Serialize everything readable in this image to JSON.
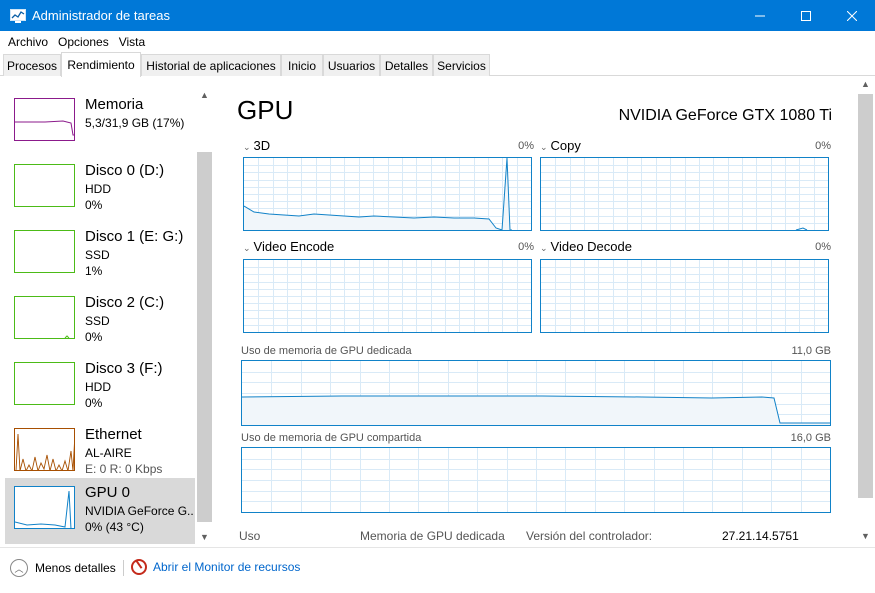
{
  "window": {
    "title": "Administrador de tareas",
    "minimize_icon": "minimize-icon",
    "maximize_icon": "maximize-icon",
    "close_icon": "close-icon"
  },
  "menu": [
    "Archivo",
    "Opciones",
    "Vista"
  ],
  "tabs": [
    "Procesos",
    "Rendimiento",
    "Historial de aplicaciones",
    "Inicio",
    "Usuarios",
    "Detalles",
    "Servicios"
  ],
  "active_tab": "Rendimiento",
  "devices": [
    {
      "name": "Memoria",
      "line1": "5,3/31,9 GB (17%)",
      "line2": "",
      "color": "#8b1a8b",
      "usage_fraction": 0.17
    },
    {
      "name": "Disco 0 (D:)",
      "line1": "HDD",
      "line2": "0%",
      "color": "#4cbb17",
      "usage_fraction": 0.0
    },
    {
      "name": "Disco 1 (E: G:)",
      "line1": "SSD",
      "line2": "1%",
      "color": "#4cbb17",
      "usage_fraction": 0.01
    },
    {
      "name": "Disco 2 (C:)",
      "line1": "SSD",
      "line2": "0%",
      "color": "#4cbb17",
      "usage_fraction": 0.0
    },
    {
      "name": "Disco 3 (F:)",
      "line1": "HDD",
      "line2": "0%",
      "color": "#4cbb17",
      "usage_fraction": 0.0
    },
    {
      "name": "Ethernet",
      "line1": "AL-AIRE",
      "line2": "E: 0 R: 0 Kbps",
      "color": "#a74f01",
      "usage_fraction": 0.0
    },
    {
      "name": "GPU 0",
      "line1": "NVIDIA GeForce G...",
      "line2": "0% (43 °C)",
      "color": "#1182c8",
      "usage_fraction": 0.0
    }
  ],
  "selected_device": "GPU 0",
  "gpu": {
    "title": "GPU",
    "model": "NVIDIA GeForce GTX 1080 Ti",
    "engines": [
      {
        "label": "3D",
        "percent": "0%"
      },
      {
        "label": "Copy",
        "percent": "0%"
      },
      {
        "label": "Video Encode",
        "percent": "0%"
      },
      {
        "label": "Video Decode",
        "percent": "0%"
      }
    ],
    "dedicated_label": "Uso de memoria de GPU dedicada",
    "dedicated_max": "11,0 GB",
    "shared_label": "Uso de memoria de GPU compartida",
    "shared_max": "16,0 GB",
    "stats": {
      "usage_label": "Uso",
      "dedicated_mem_label": "Memoria de GPU dedicada",
      "driver_label": "Versión del controlador:",
      "driver_value": "27.21.14.5751"
    }
  },
  "footer": {
    "fewer_details": "Menos detalles",
    "open_monitor": "Abrir el Monitor de recursos"
  },
  "colors": {
    "titlebar": "#0078d7",
    "graph_border": "#1182c8",
    "graph_fill": "#f1f6fa",
    "link": "#0066cc"
  }
}
